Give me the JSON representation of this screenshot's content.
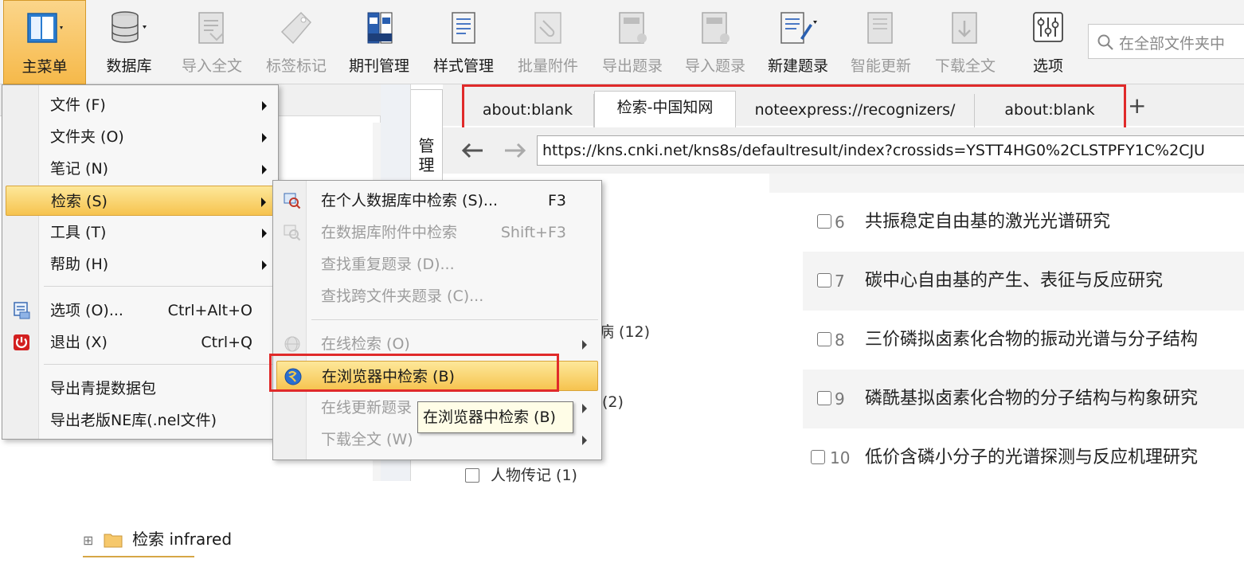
{
  "toolbar": {
    "items": [
      {
        "label": "主菜单",
        "icon": "main-menu-icon",
        "state": "active"
      },
      {
        "label": "数据库",
        "icon": "database-icon",
        "state": "enabled"
      },
      {
        "label": "导入全文",
        "icon": "import-fulltext-icon",
        "state": "disabled"
      },
      {
        "label": "标签标记",
        "icon": "tag-icon",
        "state": "disabled"
      },
      {
        "label": "期刊管理",
        "icon": "journal-icon",
        "state": "enabled"
      },
      {
        "label": "样式管理",
        "icon": "style-icon",
        "state": "enabled"
      },
      {
        "label": "批量附件",
        "icon": "attachment-icon",
        "state": "disabled"
      },
      {
        "label": "导出题录",
        "icon": "export-icon",
        "state": "disabled"
      },
      {
        "label": "导入题录",
        "icon": "import-icon",
        "state": "disabled"
      },
      {
        "label": "新建题录",
        "icon": "new-record-icon",
        "state": "enabled"
      },
      {
        "label": "智能更新",
        "icon": "smart-update-icon",
        "state": "disabled"
      },
      {
        "label": "下载全文",
        "icon": "download-icon",
        "state": "disabled"
      },
      {
        "label": "选项",
        "icon": "options-icon",
        "state": "enabled"
      }
    ],
    "search_placeholder": "在全部文件夹中"
  },
  "main_menu": {
    "items": [
      {
        "label": "文件 (F)",
        "has_submenu": true
      },
      {
        "label": "文件夹 (O)",
        "has_submenu": true
      },
      {
        "label": "笔记 (N)",
        "has_submenu": true
      },
      {
        "label": "检索 (S)",
        "has_submenu": true,
        "highlighted": true
      },
      {
        "label": "工具 (T)",
        "has_submenu": true
      },
      {
        "label": "帮助 (H)",
        "has_submenu": true
      },
      {
        "label": "选项 (O)...",
        "shortcut": "Ctrl+Alt+O",
        "icon": "options-icon"
      },
      {
        "label": "退出 (X)",
        "shortcut": "Ctrl+Q",
        "icon": "power-icon"
      },
      {
        "label": "导出青提数据包"
      },
      {
        "label": "导出老版NE库(.nel文件)"
      }
    ]
  },
  "sub_menu": {
    "items": [
      {
        "label": "在个人数据库中检索 (S)...",
        "shortcut": "F3",
        "icon": "search-icon",
        "enabled": true
      },
      {
        "label": "在数据库附件中检索",
        "shortcut": "Shift+F3",
        "icon": "search-icon",
        "enabled": false
      },
      {
        "label": "查找重复题录 (D)...",
        "enabled": false
      },
      {
        "label": "查找跨文件夹题录 (C)...",
        "enabled": false
      },
      {
        "label": "在线检索 (O)",
        "has_submenu": true,
        "icon": "globe-icon",
        "enabled": false
      },
      {
        "label": "在浏览器中检索 (B)",
        "icon": "browser-icon",
        "enabled": true,
        "highlighted": true
      },
      {
        "label": "在线更新题录",
        "has_submenu": true,
        "enabled": false
      },
      {
        "label": "下载全文 (W)",
        "has_submenu": true,
        "enabled": false
      }
    ],
    "tooltip": "在浏览器中检索 (B)"
  },
  "tree": {
    "folder_label": "检索 infrared",
    "expand_symbol": "⊞"
  },
  "side_tab": {
    "label": "管理"
  },
  "browser": {
    "tabs": [
      {
        "label": "about:blank",
        "active": false
      },
      {
        "label": "检索-中国知网",
        "active": true
      },
      {
        "label": "noteexpress://recognizers/",
        "active": false
      },
      {
        "label": "about:blank",
        "active": false
      }
    ],
    "new_tab_symbol": "+",
    "url": "https://kns.cnki.net/kns8s/defaultresult/index?crossids=YSTT4HG0%2CLSTPFY1C%2CJU"
  },
  "facets": [
    {
      "label": "病 (12)"
    },
    {
      "label": "(2)"
    },
    {
      "label": "人物传记 (1)"
    }
  ],
  "results": [
    {
      "num": "6",
      "title": "共振稳定自由基的激光光谱研究"
    },
    {
      "num": "7",
      "title": "碳中心自由基的产生、表征与反应研究"
    },
    {
      "num": "8",
      "title": "三价磷拟卤素化合物的振动光谱与分子结构"
    },
    {
      "num": "9",
      "title": "磷酰基拟卤素化合物的分子结构与构象研究"
    },
    {
      "num": "10",
      "title": "低价含磷小分子的光谱探测与反应机理研究"
    }
  ],
  "colors": {
    "accent_orange": "#f6b94a",
    "highlight_red": "#e02a2a",
    "power_red": "#d32020"
  }
}
